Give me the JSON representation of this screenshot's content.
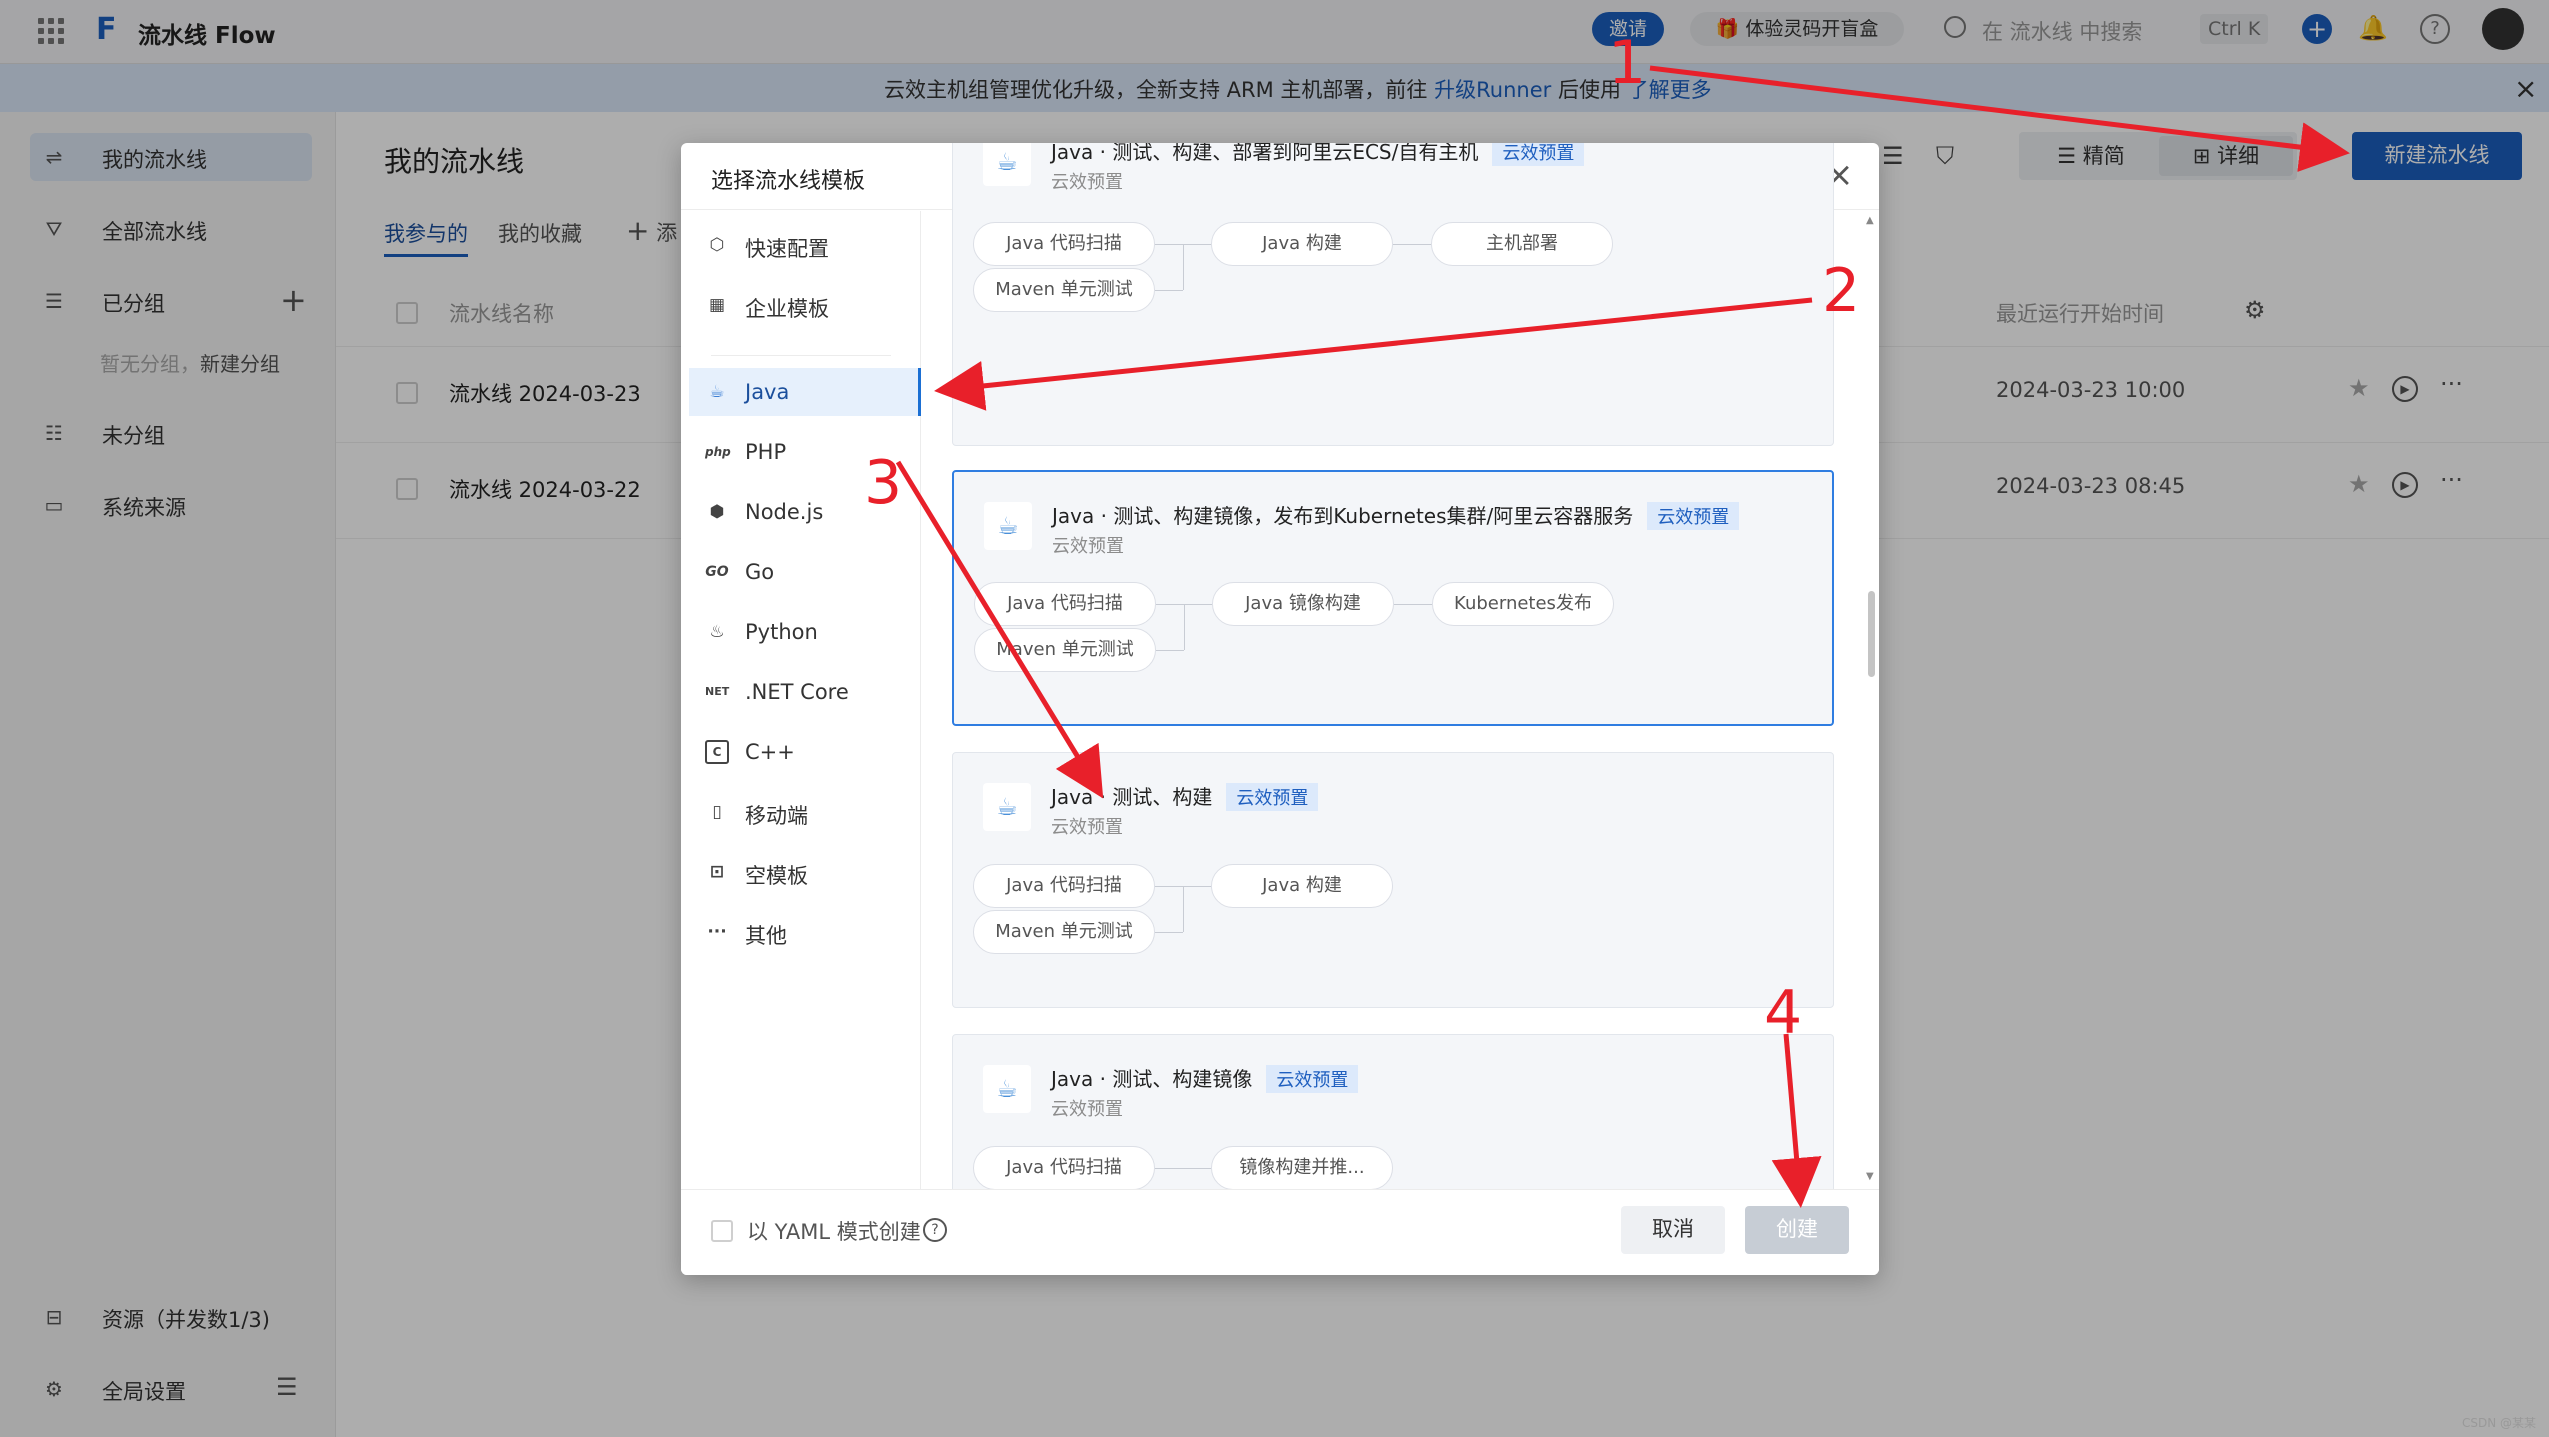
{
  "topbar": {
    "app_name": "流水线 Flow",
    "invite_label": "邀请",
    "promo_label": "体验灵码开盲盒",
    "search_placeholder": "在 流水线 中搜索",
    "shortcut": "Ctrl K"
  },
  "notice": {
    "text": "云效主机组管理优化升级，全新支持 ARM 主机部署，前往",
    "link1": "升级Runner",
    "text2": "后使用",
    "link2": "了解更多"
  },
  "sidebar": {
    "items": [
      {
        "label": "我的流水线",
        "icon": "pipeline-icon"
      },
      {
        "label": "全部流水线",
        "icon": "nodes-icon"
      },
      {
        "label": "已分组",
        "icon": "list-icon"
      },
      {
        "label": "未分组",
        "icon": "list-icon"
      },
      {
        "label": "系统来源",
        "icon": "monitor-icon"
      }
    ],
    "empty_group_text": "暂无分组，",
    "new_group_link": "新建分组",
    "resources_label": "资源（并发数1/3)",
    "settings_label": "全局设置"
  },
  "main": {
    "title": "我的流水线",
    "tabs": [
      "我参与的",
      "我的收藏",
      "添"
    ],
    "view_compact": "精简",
    "view_detail": "详细",
    "new_pipeline_button": "新建流水线",
    "col_name": "流水线名称",
    "col_last_run": "最近运行开始时间",
    "rows": [
      {
        "name": "流水线 2024-03-23",
        "time": "2024-03-23 10:00"
      },
      {
        "name": "流水线 2024-03-22",
        "time": "2024-03-23 08:45"
      }
    ]
  },
  "modal": {
    "title": "选择流水线模板",
    "categories": [
      {
        "label": "快速配置",
        "icon": "cube-icon"
      },
      {
        "label": "企业模板",
        "icon": "grid-icon"
      },
      {
        "label": "Java",
        "icon": "java-icon"
      },
      {
        "label": "PHP",
        "icon": "php-icon"
      },
      {
        "label": "Node.js",
        "icon": "nodejs-icon"
      },
      {
        "label": "Go",
        "icon": "go-icon"
      },
      {
        "label": "Python",
        "icon": "python-icon"
      },
      {
        "label": ".NET Core",
        "icon": "dotnet-icon"
      },
      {
        "label": "C++",
        "icon": "cpp-icon"
      },
      {
        "label": "移动端",
        "icon": "mobile-icon"
      },
      {
        "label": "空模板",
        "icon": "blank-icon"
      },
      {
        "label": "其他",
        "icon": "more-icon"
      }
    ],
    "templates": [
      {
        "title": "Java · 测试、构建、部署到阿里云ECS/自有主机",
        "tag": "云效预置",
        "sub": "云效预置",
        "steps": [
          "Java 代码扫描",
          "Java 构建",
          "主机部署",
          "Maven 单元测试"
        ]
      },
      {
        "title": "Java · 测试、构建镜像，发布到Kubernetes集群/阿里云容器服务",
        "tag": "云效预置",
        "sub": "云效预置",
        "steps": [
          "Java 代码扫描",
          "Java 镜像构建",
          "Kubernetes发布",
          "Maven 单元测试"
        ]
      },
      {
        "title": "Java · 测试、构建",
        "tag": "云效预置",
        "sub": "云效预置",
        "steps": [
          "Java 代码扫描",
          "Java 构建",
          "Maven 单元测试"
        ]
      },
      {
        "title": "Java · 测试、构建镜像",
        "tag": "云效预置",
        "sub": "云效预置",
        "steps": [
          "Java 代码扫描",
          "镜像构建并推..."
        ]
      }
    ],
    "yaml_label": "以 YAML 模式创建",
    "cancel_label": "取消",
    "create_label": "创建"
  },
  "annotations": [
    "1",
    "2",
    "3",
    "4"
  ],
  "watermark": "CSDN @某某",
  "colors": {
    "primary": "#1b5fbf",
    "annotation": "#e8202a"
  }
}
